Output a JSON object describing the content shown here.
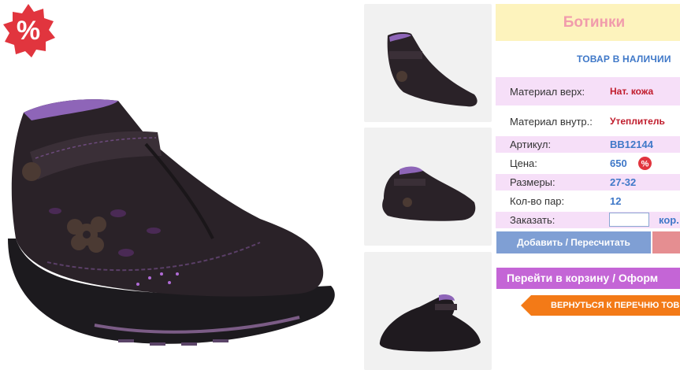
{
  "product": {
    "title": "Ботинки",
    "stock_status": "ТОВАР В НАЛИЧИИ",
    "sale_badge": "%"
  },
  "specs": [
    {
      "label": "Материал верх:",
      "value": "Нат. кожа"
    },
    {
      "label": "Материал внутр.:",
      "value": "Утеплитель"
    },
    {
      "label": "Артикул:",
      "value": "BB12144"
    },
    {
      "label": "Цена:",
      "value": "650"
    },
    {
      "label": "Размеры:",
      "value": "27-32"
    },
    {
      "label": "Кол-во пар:",
      "value": "12"
    }
  ],
  "order": {
    "label": "Заказать:",
    "quantity_value": "",
    "unit": "кор."
  },
  "buttons": {
    "add_label": "Добавить / Пересчитать",
    "cart_label": "Перейти в корзину / Оформ",
    "back_label": "ВЕРНУТЬСЯ К ПЕРЕЧНЮ ТОВ"
  },
  "colors": {
    "title_bg": "#fdf3bd",
    "title_text": "#f19cac",
    "accent_blue": "#3f78c8",
    "row_lilac": "#f6dff8",
    "cart_button": "#c465d6",
    "back_button": "#f37a17",
    "add_button": "#7f9fd4",
    "sale_red": "#e1353e"
  },
  "icons": {
    "sale": "percent-badge-icon",
    "sale_mini": "percent-mini-icon"
  }
}
